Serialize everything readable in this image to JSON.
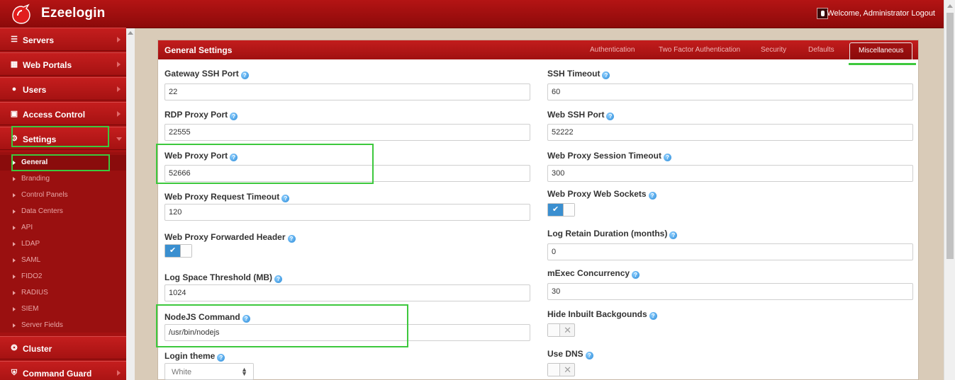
{
  "header": {
    "brand": "Ezeelogin",
    "welcome": "Welcome, Administrator Logout"
  },
  "sidebar": {
    "items": [
      {
        "label": "Servers",
        "icon": "list-icon"
      },
      {
        "label": "Web Portals",
        "icon": "grid-icon"
      },
      {
        "label": "Users",
        "icon": "users-icon"
      },
      {
        "label": "Access Control",
        "icon": "lock-icon"
      },
      {
        "label": "Settings",
        "icon": "gears-icon"
      },
      {
        "label": "Cluster",
        "icon": "cluster-icon"
      },
      {
        "label": "Command Guard",
        "icon": "shield-icon"
      }
    ],
    "settings_sub": [
      "General",
      "Branding",
      "Control Panels",
      "Data Centers",
      "API",
      "LDAP",
      "SAML",
      "FIDO2",
      "RADIUS",
      "SIEM",
      "Server Fields"
    ]
  },
  "panel": {
    "title": "General Settings",
    "tabs": [
      "Authentication",
      "Two Factor Authentication",
      "Security",
      "Defaults",
      "Miscellaneous"
    ]
  },
  "form": {
    "gateway_ssh_port": {
      "label": "Gateway SSH Port",
      "value": "22"
    },
    "ssh_timeout": {
      "label": "SSH Timeout",
      "value": "60"
    },
    "rdp_proxy_port": {
      "label": "RDP Proxy Port",
      "value": "22555"
    },
    "web_ssh_port": {
      "label": "Web SSH Port",
      "value": "52222"
    },
    "web_proxy_port": {
      "label": "Web Proxy Port",
      "value": "52666"
    },
    "web_proxy_session_timeout": {
      "label": "Web Proxy Session Timeout",
      "value": "300"
    },
    "web_proxy_request_timeout": {
      "label": "Web Proxy Request Timeout",
      "value": "120"
    },
    "web_proxy_web_sockets": {
      "label": "Web Proxy Web Sockets",
      "state": "on"
    },
    "web_proxy_forwarded_header": {
      "label": "Web Proxy Forwarded Header",
      "state": "on"
    },
    "log_retain_duration": {
      "label": "Log Retain Duration (months)",
      "value": "0"
    },
    "log_space_threshold": {
      "label": "Log Space Threshold (MB)",
      "value": "1024"
    },
    "mexec_concurrency": {
      "label": "mExec Concurrency",
      "value": "30"
    },
    "nodejs_command": {
      "label": "NodeJS Command",
      "value": "/usr/bin/nodejs"
    },
    "hide_inbuilt_backgrounds": {
      "label": "Hide Inbuilt Backgounds",
      "state": "off"
    },
    "login_theme": {
      "label": "Login theme",
      "value": "White"
    },
    "use_dns": {
      "label": "Use DNS",
      "state": "off"
    }
  },
  "colors": {
    "brand_red": "#b41414",
    "highlight_green": "#3dc83d",
    "toggle_blue": "#3a8fd0"
  }
}
